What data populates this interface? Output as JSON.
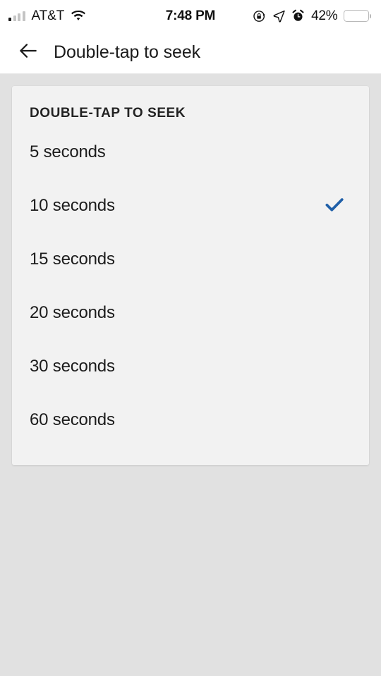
{
  "status_bar": {
    "carrier": "AT&T",
    "signal_icon": "signal-bars-icon",
    "signal_bars_active": 1,
    "signal_bars_total": 4,
    "wifi_icon": "wifi-icon",
    "time": "7:48 PM",
    "rotation_lock_icon": "rotation-lock-icon",
    "location_icon": "location-arrow-icon",
    "alarm_icon": "alarm-clock-icon",
    "battery_percent": "42%",
    "battery_level": 42,
    "battery_icon": "battery-icon",
    "battery_color": "#fdd017"
  },
  "app_bar": {
    "back_icon": "arrow-back-icon",
    "title": "Double-tap to seek"
  },
  "settings": {
    "section_title": "DOUBLE-TAP TO SEEK",
    "selected_value": "10 seconds",
    "check_icon": "check-icon",
    "accent_color": "#1f5fa8",
    "options": [
      {
        "label": "5 seconds",
        "selected": false
      },
      {
        "label": "10 seconds",
        "selected": true
      },
      {
        "label": "15 seconds",
        "selected": false
      },
      {
        "label": "20 seconds",
        "selected": false
      },
      {
        "label": "30 seconds",
        "selected": false
      },
      {
        "label": "60 seconds",
        "selected": false
      }
    ]
  },
  "colors": {
    "page_background": "#e1e1e1",
    "card_background": "#f2f2f2",
    "bar_background": "#ffffff",
    "text_primary": "#1c1c1c"
  }
}
